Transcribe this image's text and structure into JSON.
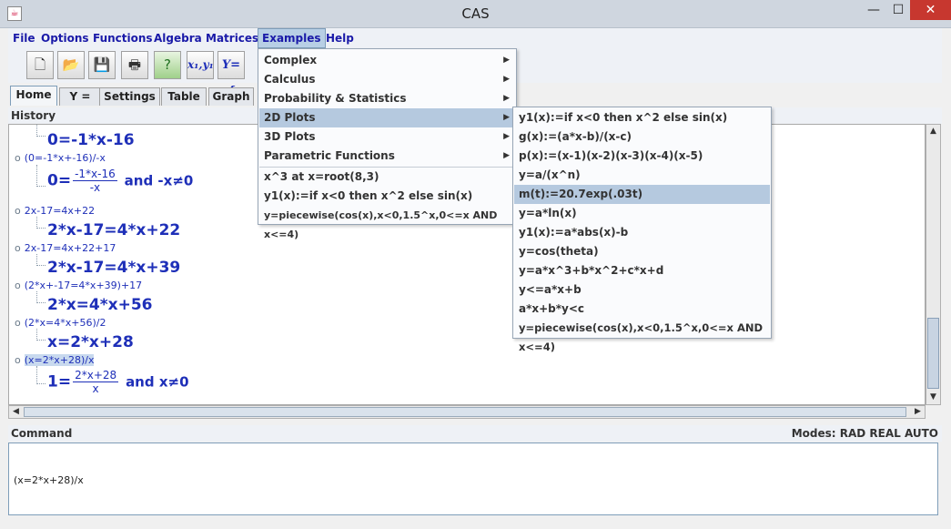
{
  "window": {
    "title": "CAS",
    "minimize": "—",
    "maximize": "☐",
    "close": "✕",
    "app_icon": "java-icon"
  },
  "menubar": [
    "File",
    "Options",
    "Functions",
    "Algebra",
    "Matrices",
    "Examples",
    "Help"
  ],
  "toolbar": {
    "buttons": [
      "new-icon",
      "open-icon",
      "save-icon",
      "print-icon",
      "help-icon",
      "x1y1-icon",
      "piecewise-icon"
    ],
    "x1y1_label": "x₁,y₁",
    "piecewise_label": "Y={"
  },
  "tabs": [
    "Home",
    "Y =",
    "Settings",
    "Table",
    "Graph"
  ],
  "history": {
    "label": "History",
    "entries": [
      {
        "input": "",
        "output": "0=-1*x-16"
      },
      {
        "input": "(0=-1*x+-16)/-x",
        "output_lhs": "0=",
        "num": "-1*x-16",
        "den": "-x",
        "output_rhs": "and -x≠0"
      },
      {
        "input": "2x-17=4x+22",
        "output": "2*x-17=4*x+22"
      },
      {
        "input": "2x-17=4x+22+17",
        "output": "2*x-17=4*x+39"
      },
      {
        "input": "(2*x+-17=4*x+39)+17",
        "output": "2*x=4*x+56"
      },
      {
        "input": "(2*x=4*x+56)/2",
        "output": "x=2*x+28"
      },
      {
        "input": "(x=2*x+28)/x",
        "output_lhs": "1=",
        "num": "2*x+28",
        "den": "x",
        "output_rhs": "and x≠0"
      }
    ]
  },
  "command": {
    "label": "Command",
    "modes": "Modes: RAD REAL AUTO",
    "value": "(x=2*x+28)/x"
  },
  "examples_menu": {
    "items": [
      "Complex",
      "Calculus",
      "Probability & Statistics",
      "2D Plots",
      "3D Plots",
      "Parametric Functions"
    ],
    "direct": [
      "x^3 at x=root(8,3)",
      "y1(x):=if x<0 then x^2 else sin(x)",
      "y=piecewise(cos(x),x<0,1.5^x,0<=x AND x<=4)"
    ],
    "submenu_arrow": "▶"
  },
  "plots_submenu": {
    "items": [
      "y1(x):=if x<0 then x^2 else sin(x)",
      "g(x):=(a*x-b)/(x-c)",
      "p(x):=(x-1)(x-2)(x-3)(x-4)(x-5)",
      "y=a/(x^n)",
      "m(t):=20.7exp(.03t)",
      "y=a*ln(x)",
      "y1(x):=a*abs(x)-b",
      "y=cos(theta)",
      "y=a*x^3+b*x^2+c*x+d",
      "y<=a*x+b",
      "a*x+b*y<c",
      "y=piecewise(cos(x),x<0,1.5^x,0<=x AND x<=4)"
    ]
  }
}
